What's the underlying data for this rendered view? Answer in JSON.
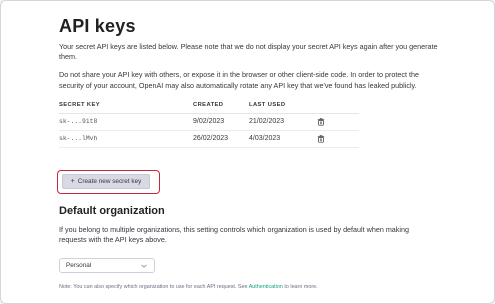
{
  "page": {
    "title": "API keys",
    "intro": "Your secret API keys are listed below. Please note that we do not display your secret API keys again after you generate them.",
    "warning": "Do not share your API key with others, or expose it in the browser or other client-side code. In order to protect the security of your account, OpenAI may also automatically rotate any API key that we've found has leaked publicly."
  },
  "keys_table": {
    "headers": [
      "SECRET KEY",
      "CREATED",
      "LAST USED"
    ],
    "rows": [
      {
        "key": "sk-...9it8",
        "created": "9/02/2023",
        "last_used": "21/02/2023"
      },
      {
        "key": "sk-...lMvh",
        "created": "26/02/2023",
        "last_used": "4/03/2023"
      }
    ]
  },
  "create_button": {
    "icon": "plus",
    "label": "Create new secret key"
  },
  "default_org": {
    "heading": "Default organization",
    "description": "If you belong to multiple organizations, this setting controls which organization is used by default when making requests with the API keys above.",
    "selected": "Personal"
  },
  "note": {
    "before": "Note: You can also specify which organization to use for each API request. See ",
    "link": "Authentication",
    "after": " to learn more."
  },
  "colors": {
    "accent": "#10a37f",
    "highlight": "#c9253c"
  }
}
